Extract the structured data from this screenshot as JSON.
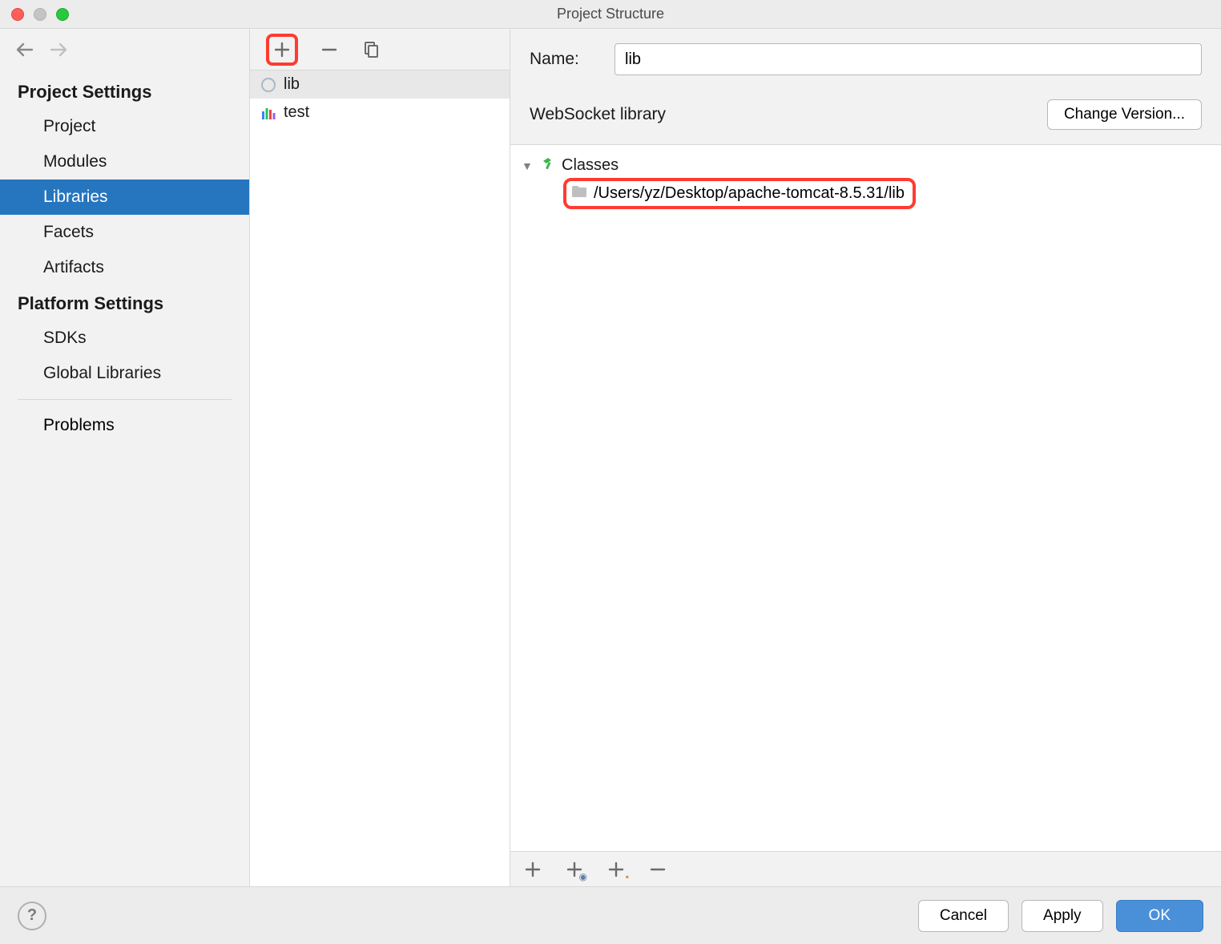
{
  "window": {
    "title": "Project Structure"
  },
  "sidebar": {
    "section1_header": "Project Settings",
    "section1_items": [
      "Project",
      "Modules",
      "Libraries",
      "Facets",
      "Artifacts"
    ],
    "section1_selected_index": 2,
    "section2_header": "Platform Settings",
    "section2_items": [
      "SDKs",
      "Global Libraries"
    ],
    "problems_label": "Problems"
  },
  "liblist": {
    "items": [
      {
        "name": "lib",
        "icon": "lib"
      },
      {
        "name": "test",
        "icon": "bars"
      }
    ],
    "selected_index": 0
  },
  "detail": {
    "name_label": "Name:",
    "name_value": "lib",
    "libtype_label": "WebSocket library",
    "change_version_label": "Change Version...",
    "tree": {
      "root_label": "Classes",
      "children": [
        {
          "path": "/Users/yz/Desktop/apache-tomcat-8.5.31/lib"
        }
      ]
    }
  },
  "footer": {
    "cancel": "Cancel",
    "apply": "Apply",
    "ok": "OK"
  }
}
